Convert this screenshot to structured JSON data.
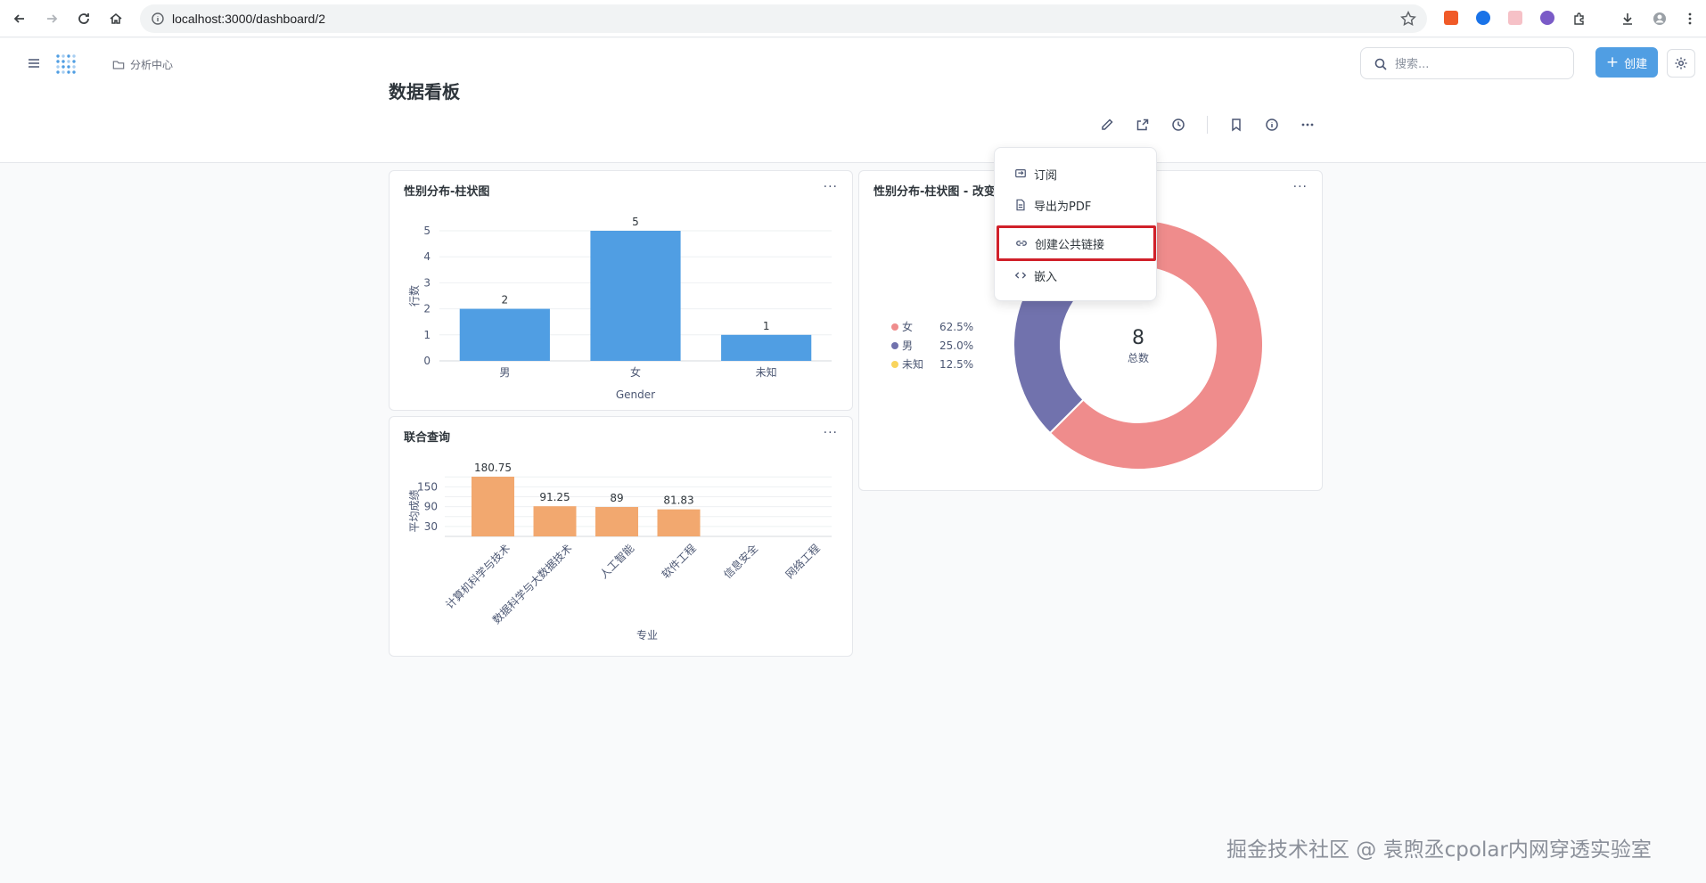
{
  "browser": {
    "url": "localhost:3000/dashboard/2"
  },
  "header": {
    "breadcrumb": "分析中心",
    "search_placeholder": "搜索...",
    "create_label": "创建"
  },
  "page": {
    "title": "数据看板"
  },
  "cards": {
    "bar": {
      "title": "性别分布-柱状图",
      "menu": "···"
    },
    "donut": {
      "title": "性别分布-柱状图 - 改变",
      "menu": "···"
    },
    "join": {
      "title": "联合查询",
      "menu": "···"
    }
  },
  "dropdown": {
    "items": [
      {
        "label": "订阅",
        "icon": "subscribe-icon"
      },
      {
        "label": "导出为PDF",
        "icon": "document-icon"
      },
      {
        "label": "创建公共链接",
        "icon": "link-icon"
      },
      {
        "label": "嵌入",
        "icon": "code-icon"
      }
    ]
  },
  "colors": {
    "bar_blue": "#509ee3",
    "bar_orange": "#f2a86f",
    "female": "#ef8c8c",
    "male": "#7172ad",
    "unknown": "#f9d45c",
    "highlight": "#d0202a"
  },
  "chart_data": [
    {
      "type": "bar",
      "categories": [
        "男",
        "女",
        "未知"
      ],
      "values": [
        2,
        5,
        1
      ],
      "title": "性别分布-柱状图",
      "xlabel": "Gender",
      "ylabel": "行数",
      "ylim": [
        0,
        5
      ],
      "yticks": [
        0,
        1,
        2,
        3,
        4,
        5
      ],
      "grid": true
    },
    {
      "type": "pie",
      "title": "性别分布-柱状图 - 改变",
      "labels": [
        "女",
        "男",
        "未知"
      ],
      "values": [
        5,
        2,
        1
      ],
      "percent_labels": [
        "62.5%",
        "25.0%",
        "12.5%"
      ],
      "center_value": "8",
      "center_label": "总数",
      "legend": "left"
    },
    {
      "type": "bar",
      "title": "联合查询",
      "categories": [
        "计算机科学与技术",
        "数据科学与大数据技术",
        "人工智能",
        "软件工程",
        "信息安全",
        "网络工程"
      ],
      "values": [
        180.75,
        91.25,
        89,
        81.83,
        null,
        null
      ],
      "data_labels": [
        "180.75",
        "91.25",
        "89",
        "81.83",
        "",
        ""
      ],
      "xlabel": "专业",
      "ylabel": "平均成绩",
      "yticks": [
        30,
        90,
        150
      ],
      "ylim": [
        0,
        180.75
      ],
      "grid": true
    }
  ],
  "watermark": "掘金技术社区 @ 袁煦丞cpolar内网穿透实验室"
}
